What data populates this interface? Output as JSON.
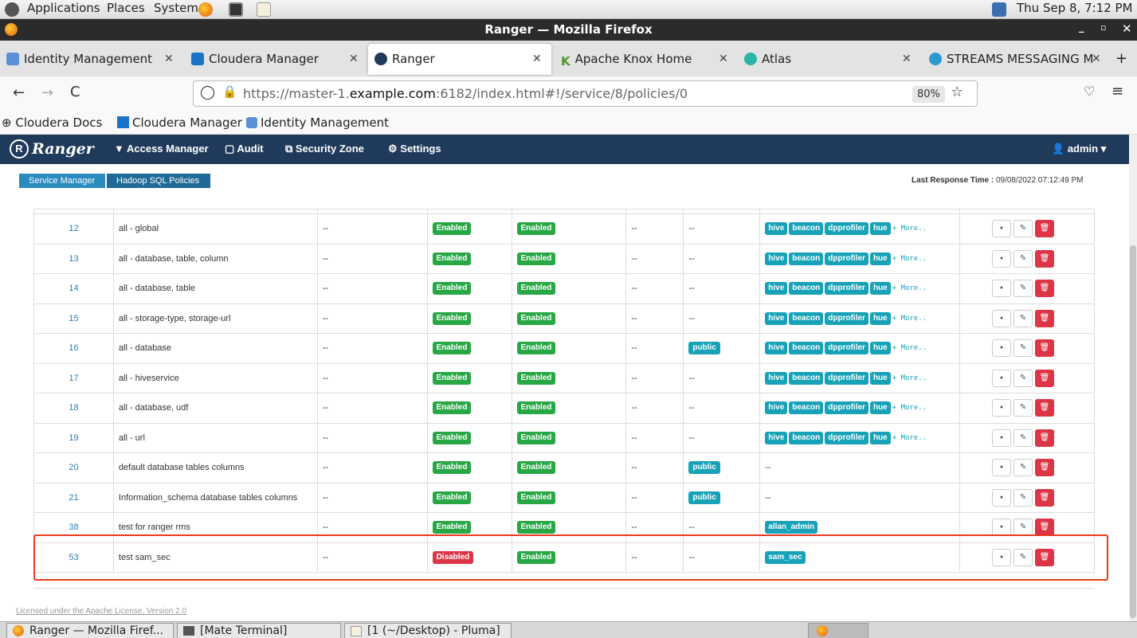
{
  "panel": {
    "applications": "Applications",
    "places": "Places",
    "system": "System",
    "clock": "Thu Sep  8,  7:12 PM"
  },
  "window": {
    "title": "Ranger — Mozilla Firefox"
  },
  "tabs": [
    {
      "label": "Identity Management",
      "color": "#5b8fd6"
    },
    {
      "label": "Cloudera Manager",
      "color": "#1a73c7"
    },
    {
      "label": "Ranger",
      "color": "#1f3a5a"
    },
    {
      "label": "Apache Knox Home",
      "color": "#4a9a2a"
    },
    {
      "label": "Atlas",
      "color": "#2bb5a8"
    },
    {
      "label": "STREAMS MESSAGING M",
      "color": "#2b9ad0"
    }
  ],
  "nav": {
    "url_pre": "https://master-1.",
    "url_domain": "example.com",
    "url_post": ":6182/index.html#!/service/8/policies/0",
    "zoom": "80%"
  },
  "bookmarks": [
    {
      "label": "Cloudera Docs"
    },
    {
      "label": "Cloudera Manager"
    },
    {
      "label": "Identity Management"
    }
  ],
  "ranger": {
    "brand": "Ranger",
    "menu": [
      "Access Manager",
      "Audit",
      "Security Zone",
      "Settings"
    ],
    "user": "admin",
    "breadcrumb": [
      "Service Manager",
      "Hadoop SQL Policies"
    ],
    "last_response_label": "Last Response Time : ",
    "last_response_value": "09/08/2022 07:12:49 PM",
    "footer": "Licensed under the Apache License, Version 2.0"
  },
  "policies": [
    {
      "id": "12",
      "name": "all - global",
      "labels": "--",
      "status": "Enabled",
      "audit": "Enabled",
      "roles": "--",
      "groups": "--",
      "users": [
        "hive",
        "beacon",
        "dpprofiler",
        "hue"
      ],
      "more": "+ More.."
    },
    {
      "id": "13",
      "name": "all - database, table, column",
      "labels": "--",
      "status": "Enabled",
      "audit": "Enabled",
      "roles": "--",
      "groups": "--",
      "users": [
        "hive",
        "beacon",
        "dpprofiler",
        "hue"
      ],
      "more": "+ More.."
    },
    {
      "id": "14",
      "name": "all - database, table",
      "labels": "--",
      "status": "Enabled",
      "audit": "Enabled",
      "roles": "--",
      "groups": "--",
      "users": [
        "hive",
        "beacon",
        "dpprofiler",
        "hue"
      ],
      "more": "+ More.."
    },
    {
      "id": "15",
      "name": "all - storage-type, storage-url",
      "labels": "--",
      "status": "Enabled",
      "audit": "Enabled",
      "roles": "--",
      "groups": "--",
      "users": [
        "hive",
        "beacon",
        "dpprofiler",
        "hue"
      ],
      "more": "+ More.."
    },
    {
      "id": "16",
      "name": "all - database",
      "labels": "--",
      "status": "Enabled",
      "audit": "Enabled",
      "roles": "--",
      "groups": "public",
      "users": [
        "hive",
        "beacon",
        "dpprofiler",
        "hue"
      ],
      "more": "+ More.."
    },
    {
      "id": "17",
      "name": "all - hiveservice",
      "labels": "--",
      "status": "Enabled",
      "audit": "Enabled",
      "roles": "--",
      "groups": "--",
      "users": [
        "hive",
        "beacon",
        "dpprofiler",
        "hue"
      ],
      "more": "+ More.."
    },
    {
      "id": "18",
      "name": "all - database, udf",
      "labels": "--",
      "status": "Enabled",
      "audit": "Enabled",
      "roles": "--",
      "groups": "--",
      "users": [
        "hive",
        "beacon",
        "dpprofiler",
        "hue"
      ],
      "more": "+ More.."
    },
    {
      "id": "19",
      "name": "all - url",
      "labels": "--",
      "status": "Enabled",
      "audit": "Enabled",
      "roles": "--",
      "groups": "--",
      "users": [
        "hive",
        "beacon",
        "dpprofiler",
        "hue"
      ],
      "more": "+ More.."
    },
    {
      "id": "20",
      "name": "default database tables columns",
      "labels": "--",
      "status": "Enabled",
      "audit": "Enabled",
      "roles": "--",
      "groups": "public",
      "users": [],
      "users_text": "--",
      "more": ""
    },
    {
      "id": "21",
      "name": "Information_schema database tables columns",
      "labels": "--",
      "status": "Enabled",
      "audit": "Enabled",
      "roles": "--",
      "groups": "public",
      "users": [],
      "users_text": "--",
      "more": ""
    },
    {
      "id": "38",
      "name": "test for ranger rms",
      "labels": "--",
      "status": "Enabled",
      "audit": "Enabled",
      "roles": "--",
      "groups": "--",
      "users": [
        "allan_admin"
      ],
      "more": ""
    },
    {
      "id": "53",
      "name": "test sam_sec",
      "labels": "--",
      "status": "Disabled",
      "audit": "Enabled",
      "roles": "--",
      "groups": "--",
      "users": [
        "sam_sec"
      ],
      "more": ""
    }
  ],
  "taskbar": [
    {
      "label": "Ranger — Mozilla Firef..."
    },
    {
      "label": "[Mate Terminal]"
    },
    {
      "label": "[1 (~/Desktop) - Pluma]"
    }
  ]
}
